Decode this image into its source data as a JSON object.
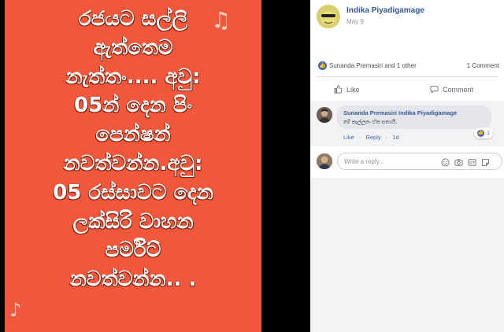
{
  "image": {
    "lines": [
      "රජයට සල්ලි",
      "ඇත්තෙම",
      "නැත්තං.... අවු:",
      "05න් දෙන පිං",
      "පෙන්ෂන්",
      "නවත්වන්න.අවු:",
      "05 රස්සාවට දෙන",
      "ලක්සිරි වාහන",
      "පර්මිට්",
      "නවත්වන්න.. ."
    ],
    "note_glyph": "♫",
    "note_glyph_single": "♪",
    "background": "#f0573b"
  },
  "post": {
    "author": "Indika Piyadigamage",
    "date": "May 9"
  },
  "reactions": {
    "reactors": "Sunanda Premasiri and 1 other",
    "comment_count": "1 Comment"
  },
  "actions": {
    "like_label": "Like",
    "comment_label": "Comment"
  },
  "comment": {
    "names": "Sunanda Premasiri Indika Piyadigamage",
    "text": "මේ කෑල්ලනං ඒක සත්‍යයි.",
    "reaction_count": "1",
    "like_link": "Like",
    "separator": "·",
    "reply_link": "Reply",
    "age": "1d"
  },
  "reply": {
    "placeholder": "Write a reply..."
  },
  "colors": {
    "facebook_blue": "#4267b2",
    "link_blue": "#385898"
  },
  "icons": [
    "like-icon",
    "comment-icon",
    "emoji-icon",
    "camera-icon",
    "gif-icon",
    "sticker-icon"
  ]
}
